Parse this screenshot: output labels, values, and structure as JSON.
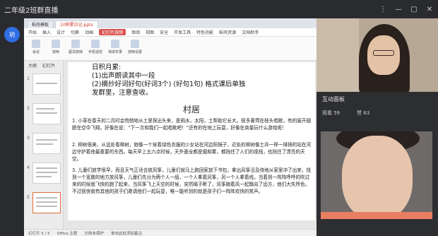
{
  "live": {
    "title": "二年级2班群直播",
    "controls": [
      "⋮",
      "—",
      "▢",
      "✕"
    ]
  },
  "avatar": {
    "initials": "玥"
  },
  "ppt": {
    "tabs": [
      "稻壳模板",
      "10积累日记.pptx"
    ],
    "ribbon_tabs": [
      "开始",
      "插入",
      "设计",
      "切换",
      "动画",
      "幻灯片放映",
      "审阅",
      "视图",
      "安全",
      "开发工具",
      "特色功能",
      "稻壳资源",
      "文档助手"
    ],
    "ribbon_buttons": [
      "会议",
      "放映",
      "超清放映",
      "手机遥控",
      "演讲实录",
      "放映设置"
    ],
    "panel_labels": [
      "大纲",
      "幻灯片"
    ],
    "thumbs": [
      {
        "num": "1"
      },
      {
        "num": "2"
      },
      {
        "num": "3"
      },
      {
        "num": "4"
      },
      {
        "num": "5"
      }
    ],
    "slide": {
      "memo_lines": [
        "日积月累:",
        "(1)出声朗读其中一段",
        "(2)摘抄好词好句(好词3个)  (好句1句)  格式课后单独",
        "发群里，注意查收。"
      ],
      "title": "村居",
      "para1": "1. 小草在春天的二月时会悄悄地从土里探出头来，是雨水，太阳，土帮助它长大。很多黄莺在枝头唱歌，有的展开翅膀在空中飞翔，好像在说：“下一次和我们一起唱歌吧！”还有的在地上玩耍，好像在商量玩什么游戏呢！",
      "para2": "2. 柳树很美，从远处看柳树，她像一个穿着绿色衣服的少女站在河边照镜子，近处的柳树像士兵一样一排排的站在河边守护着他最重要的东西。每天早上五六点时候，天外面全都是烟和雾，都挡住了人们的视线，也挡住了漂亮的天空。",
      "para3": "3. 儿童们放学很早，而且天气正适合放风筝，儿童们就马上跑回家放下书包，拿出风筝沿及待地从家里冲了出来，找到一个宽敞的地方放风筝，儿童们先分为两个人一组，一个人拿着风筝，另一个人拿着线，当着到一阵阵呼呼的吹过来的时候就飞快的跑了起来，当风筝飞上天空的时候，突然绳子断了，风筝随着风一起飘向了远方，他们大失所色，不过很快就有其他的孩子们邀请他们一起玩耍，唯一能听到的就是孩子们一阵阵欢快的笑声。"
    },
    "status": [
      "幻灯片 5 / 5",
      "Office 主题",
      "文档未保护",
      "单击此处添加备注"
    ]
  },
  "interact": {
    "title": "互动面板",
    "viewers": "观看 59",
    "likes": "赞 63"
  },
  "colors": {
    "accent": "#d9534f",
    "live_bg": "#2a2b2f",
    "avatar_bg": "#2f6de1"
  }
}
